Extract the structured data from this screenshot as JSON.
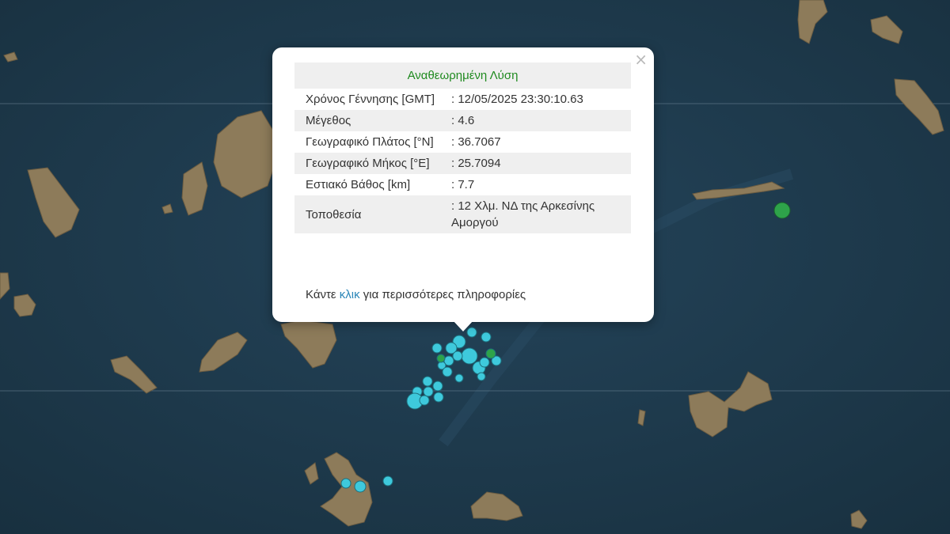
{
  "popup": {
    "title": "Αναθεωρημένη Λύση",
    "close_symbol": "×",
    "rows": [
      {
        "label": "Χρόνος Γέννησης [GMT]",
        "value": ": 12/05/2025 23:30:10.63"
      },
      {
        "label": "Μέγεθος",
        "value": ": 4.6"
      },
      {
        "label": "Γεωγραφικό Πλάτος [°N]",
        "value": ": 36.7067"
      },
      {
        "label": "Γεωγραφικό Μήκος [°E]",
        "value": ": 25.7094"
      },
      {
        "label": "Εστιακό Βάθος [km]",
        "value": ": 7.7"
      },
      {
        "label": "Τοποθεσία",
        "value": ": 12 Χλμ. ΝΔ της Αρκεσίνης Αμοργού"
      }
    ],
    "more_prefix": "Κάντε",
    "more_link": "κλικ",
    "more_suffix": "για περισσότερες πληροφορίες"
  },
  "colors": {
    "sea": "#1f3a4f",
    "land": "#8a7a5c",
    "marker_cyan": "#3ec9dc",
    "marker_green": "#2ea34a",
    "title_green": "#1f8a1f",
    "link": "#2a86b8"
  }
}
